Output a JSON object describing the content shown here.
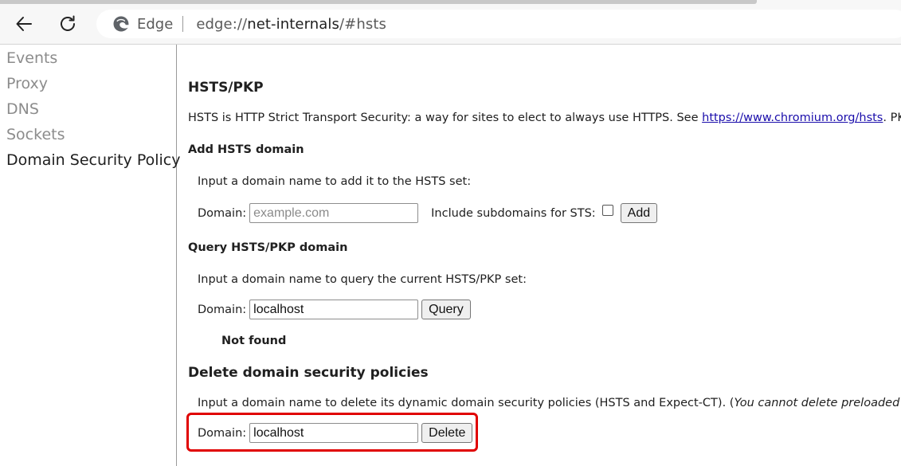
{
  "browser": {
    "browser_name": "Edge",
    "url_scheme": "edge://",
    "url_host": "net-internals",
    "url_path": "/#hsts"
  },
  "sidebar": {
    "items": [
      {
        "label": "Events"
      },
      {
        "label": "Proxy"
      },
      {
        "label": "DNS"
      },
      {
        "label": "Sockets"
      },
      {
        "label": "Domain Security Policy",
        "active": true
      }
    ]
  },
  "main": {
    "title": "HSTS/PKP",
    "intro_before": "HSTS is HTTP Strict Transport Security: a way for sites to elect to always use HTTPS. See ",
    "intro_link": "https://www.chromium.org/hsts",
    "intro_after": ". PKP is Public Key",
    "add": {
      "heading": "Add HSTS domain",
      "description": "Input a domain name to add it to the HSTS set:",
      "domain_label": "Domain:",
      "placeholder": "example.com",
      "value": "",
      "subdomains_label": "Include subdomains for STS:",
      "subdomains_checked": false,
      "button": "Add"
    },
    "query": {
      "heading": "Query HSTS/PKP domain",
      "description": "Input a domain name to query the current HSTS/PKP set:",
      "domain_label": "Domain:",
      "value": "localhost",
      "button": "Query",
      "result": "Not found"
    },
    "delete": {
      "heading": "Delete domain security policies",
      "description_before": "Input a domain name to delete its dynamic domain security policies (HSTS and Expect-CT). (",
      "description_italic": "You cannot delete preloaded entries.",
      "description_after": "):",
      "domain_label": "Domain:",
      "value": "localhost",
      "button": "Delete"
    }
  },
  "colors": {
    "highlight": "#e00000",
    "link": "#1a0dab"
  }
}
